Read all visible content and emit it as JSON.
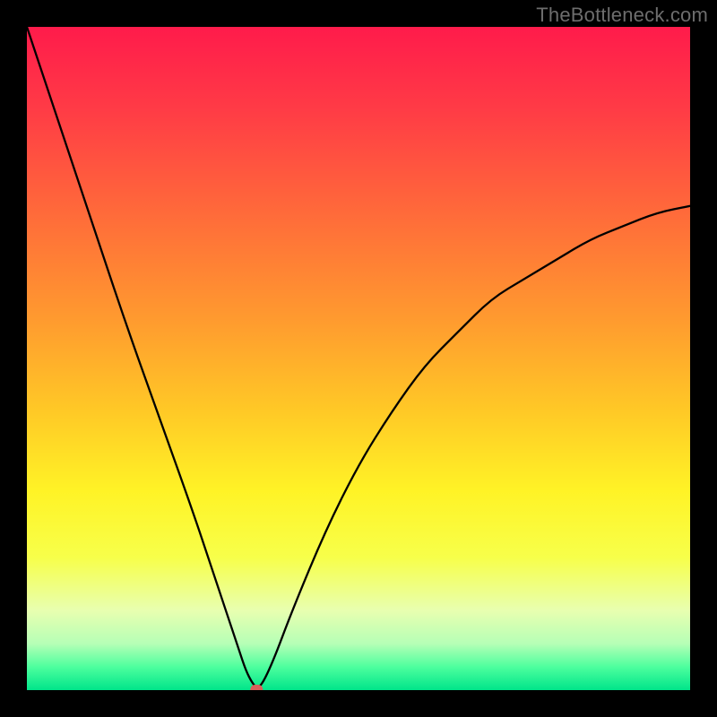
{
  "watermark": "TheBottleneck.com",
  "chart_data": {
    "type": "line",
    "title": "",
    "xlabel": "",
    "ylabel": "",
    "xlim": [
      0,
      100
    ],
    "ylim": [
      0,
      100
    ],
    "grid": false,
    "legend": false,
    "series": [
      {
        "name": "bottleneck-curve",
        "x": [
          0,
          5,
          10,
          15,
          20,
          25,
          28,
          30,
          32,
          33,
          34,
          35,
          37,
          40,
          45,
          50,
          55,
          60,
          65,
          70,
          75,
          80,
          85,
          90,
          95,
          100
        ],
        "y": [
          100,
          85,
          70,
          55,
          41,
          27,
          18,
          12,
          6,
          3,
          1,
          0,
          4,
          12,
          24,
          34,
          42,
          49,
          54,
          59,
          62,
          65,
          68,
          70,
          72,
          73
        ]
      }
    ],
    "marker": {
      "x": 34.5,
      "y": 0,
      "color": "#d85f5a",
      "label": "optimal-point"
    },
    "background_gradient": {
      "stops": [
        {
          "pos": 0.0,
          "color": "#ff1b4b"
        },
        {
          "pos": 0.12,
          "color": "#ff3a46"
        },
        {
          "pos": 0.28,
          "color": "#ff6a3a"
        },
        {
          "pos": 0.44,
          "color": "#ff9a2f"
        },
        {
          "pos": 0.58,
          "color": "#ffc926"
        },
        {
          "pos": 0.7,
          "color": "#fff326"
        },
        {
          "pos": 0.8,
          "color": "#f7ff4a"
        },
        {
          "pos": 0.88,
          "color": "#e8ffb0"
        },
        {
          "pos": 0.93,
          "color": "#b6ffb6"
        },
        {
          "pos": 0.965,
          "color": "#4dff9e"
        },
        {
          "pos": 1.0,
          "color": "#00e58a"
        }
      ]
    }
  }
}
